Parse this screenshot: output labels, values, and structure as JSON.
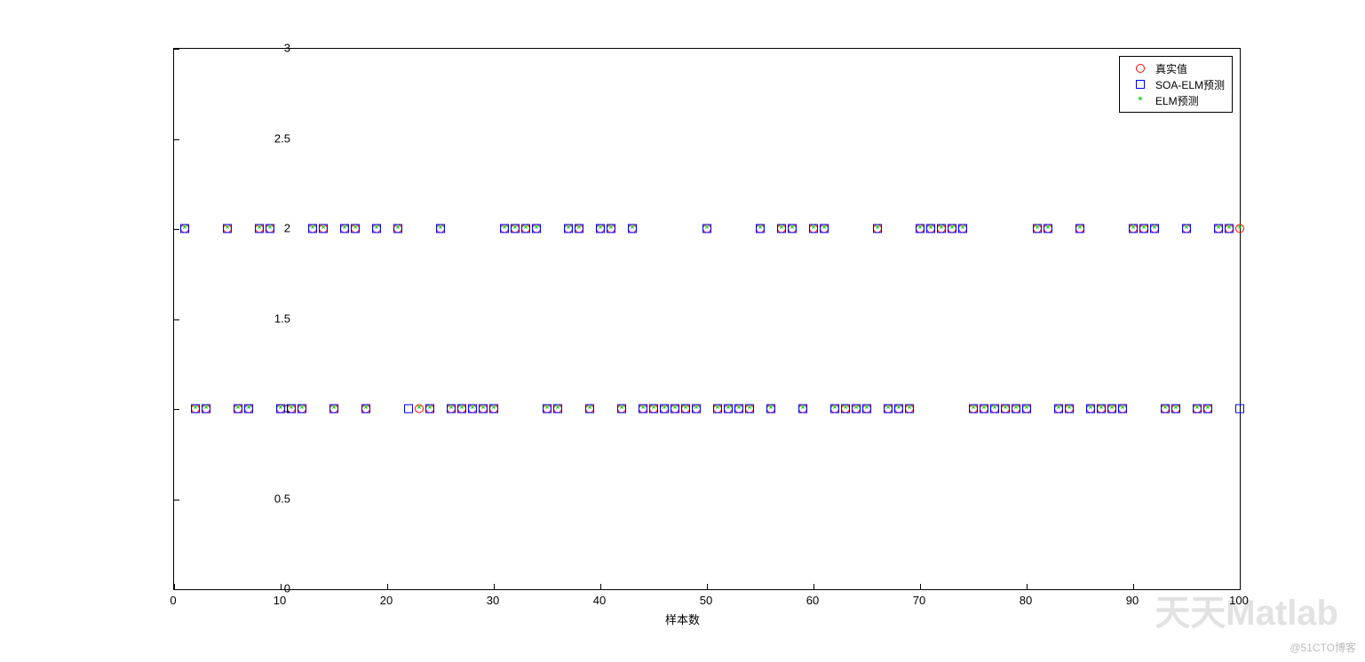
{
  "chart_data": {
    "type": "scatter",
    "xlabel": "样本数",
    "ylabel": "",
    "xlim": [
      0,
      100
    ],
    "ylim": [
      0,
      3
    ],
    "xticks": [
      0,
      10,
      20,
      30,
      40,
      50,
      60,
      70,
      80,
      90,
      100
    ],
    "yticks": [
      0,
      0.5,
      1,
      1.5,
      2,
      2.5,
      3
    ],
    "legend_position": "top-right",
    "series": [
      {
        "name": "真实值",
        "marker": "circle",
        "color": "#ff0000",
        "x": [
          1,
          2,
          3,
          5,
          6,
          7,
          8,
          9,
          10,
          11,
          12,
          13,
          14,
          15,
          16,
          17,
          18,
          19,
          21,
          23,
          24,
          25,
          26,
          27,
          28,
          29,
          30,
          31,
          32,
          33,
          34,
          35,
          36,
          37,
          38,
          39,
          40,
          41,
          42,
          43,
          44,
          45,
          46,
          47,
          48,
          49,
          50,
          51,
          52,
          53,
          54,
          55,
          56,
          57,
          58,
          59,
          60,
          61,
          62,
          63,
          64,
          65,
          66,
          67,
          68,
          69,
          70,
          71,
          72,
          73,
          74,
          75,
          76,
          77,
          78,
          79,
          80,
          81,
          82,
          83,
          84,
          85,
          86,
          87,
          88,
          89,
          90,
          91,
          92,
          93,
          94,
          95,
          96,
          97,
          98,
          99,
          100
        ],
        "y": [
          2,
          1,
          1,
          2,
          1,
          1,
          2,
          2,
          1,
          1,
          1,
          2,
          2,
          1,
          2,
          2,
          1,
          2,
          2,
          1,
          1,
          2,
          1,
          1,
          1,
          1,
          1,
          2,
          2,
          2,
          2,
          1,
          1,
          2,
          2,
          1,
          2,
          2,
          1,
          2,
          1,
          1,
          1,
          1,
          1,
          1,
          2,
          1,
          1,
          1,
          1,
          2,
          1,
          2,
          2,
          1,
          2,
          2,
          1,
          1,
          1,
          1,
          2,
          1,
          1,
          1,
          2,
          2,
          2,
          2,
          2,
          1,
          1,
          1,
          1,
          1,
          1,
          2,
          2,
          1,
          1,
          2,
          1,
          1,
          1,
          1,
          2,
          2,
          2,
          1,
          1,
          2,
          1,
          1,
          2,
          2,
          2
        ]
      },
      {
        "name": "SOA-ELM预测",
        "marker": "square",
        "color": "#0000ff",
        "x": [
          1,
          2,
          3,
          5,
          6,
          7,
          8,
          9,
          10,
          11,
          12,
          13,
          14,
          15,
          16,
          17,
          18,
          19,
          21,
          22,
          24,
          25,
          26,
          27,
          28,
          29,
          30,
          31,
          32,
          33,
          34,
          35,
          36,
          37,
          38,
          39,
          40,
          41,
          42,
          43,
          44,
          45,
          46,
          47,
          48,
          49,
          50,
          51,
          52,
          53,
          54,
          55,
          56,
          57,
          58,
          59,
          60,
          61,
          62,
          63,
          64,
          65,
          66,
          67,
          68,
          69,
          70,
          71,
          72,
          73,
          74,
          75,
          76,
          77,
          78,
          79,
          80,
          81,
          82,
          83,
          84,
          85,
          86,
          87,
          88,
          89,
          90,
          91,
          92,
          93,
          94,
          95,
          96,
          97,
          98,
          99,
          100
        ],
        "y": [
          2,
          1,
          1,
          2,
          1,
          1,
          2,
          2,
          1,
          1,
          1,
          2,
          2,
          1,
          2,
          2,
          1,
          2,
          2,
          1,
          1,
          2,
          1,
          1,
          1,
          1,
          1,
          2,
          2,
          2,
          2,
          1,
          1,
          2,
          2,
          1,
          2,
          2,
          1,
          2,
          1,
          1,
          1,
          1,
          1,
          1,
          2,
          1,
          1,
          1,
          1,
          2,
          1,
          2,
          2,
          1,
          2,
          2,
          1,
          1,
          1,
          1,
          2,
          1,
          1,
          1,
          2,
          2,
          2,
          2,
          2,
          1,
          1,
          1,
          1,
          1,
          1,
          2,
          2,
          1,
          1,
          2,
          1,
          1,
          1,
          1,
          2,
          2,
          2,
          1,
          1,
          2,
          1,
          1,
          2,
          2,
          1
        ]
      },
      {
        "name": "ELM预测",
        "marker": "star",
        "color": "#00c000",
        "x": [
          1,
          2,
          3,
          5,
          6,
          7,
          8,
          9,
          10,
          11,
          12,
          13,
          14,
          15,
          16,
          17,
          18,
          19,
          21,
          23,
          24,
          25,
          26,
          27,
          28,
          29,
          30,
          31,
          32,
          33,
          34,
          35,
          36,
          37,
          38,
          39,
          40,
          41,
          42,
          43,
          44,
          45,
          46,
          47,
          48,
          49,
          50,
          51,
          52,
          53,
          54,
          55,
          56,
          57,
          58,
          59,
          60,
          61,
          62,
          63,
          64,
          65,
          66,
          67,
          68,
          69,
          70,
          71,
          72,
          73,
          74,
          75,
          76,
          77,
          78,
          79,
          80,
          81,
          82,
          83,
          84,
          85,
          86,
          87,
          88,
          89,
          90,
          91,
          92,
          93,
          94,
          95,
          96,
          97,
          98,
          99,
          100
        ],
        "y": [
          2,
          1,
          1,
          2,
          1,
          1,
          2,
          2,
          1,
          1,
          1,
          2,
          2,
          1,
          2,
          2,
          1,
          2,
          2,
          1,
          1,
          2,
          1,
          1,
          1,
          1,
          1,
          2,
          2,
          2,
          2,
          1,
          1,
          2,
          2,
          1,
          2,
          2,
          1,
          2,
          1,
          1,
          1,
          1,
          1,
          1,
          2,
          1,
          1,
          1,
          1,
          2,
          1,
          2,
          2,
          1,
          2,
          2,
          1,
          1,
          1,
          1,
          2,
          1,
          1,
          1,
          2,
          2,
          2,
          2,
          2,
          1,
          1,
          1,
          1,
          1,
          1,
          2,
          2,
          1,
          1,
          2,
          1,
          1,
          1,
          1,
          2,
          2,
          2,
          1,
          1,
          2,
          1,
          1,
          2,
          2,
          2
        ]
      }
    ]
  },
  "watermark": {
    "main": "天天Matlab",
    "small": "@51CTO博客"
  }
}
